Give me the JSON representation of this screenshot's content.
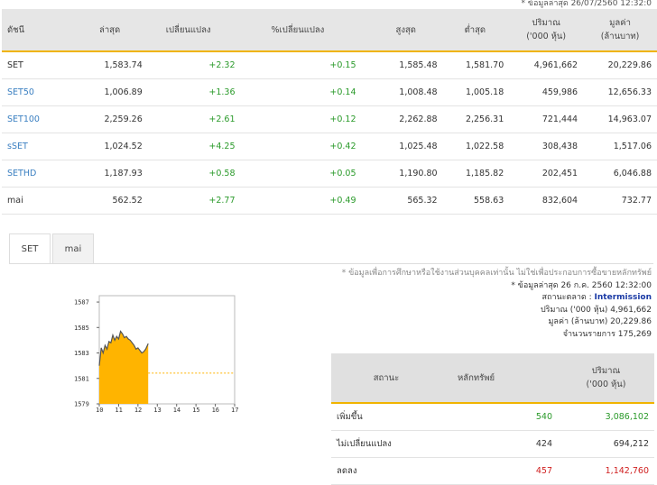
{
  "updated": "* ข้อมูลล่าสุด 26/07/2560 12:32:0",
  "index_table": {
    "headers": [
      {
        "l1": "ดัชนี",
        "l2": ""
      },
      {
        "l1": "ล่าสุด",
        "l2": ""
      },
      {
        "l1": "เปลี่ยนแปลง",
        "l2": ""
      },
      {
        "l1": "%เปลี่ยนแปลง",
        "l2": ""
      },
      {
        "l1": "สูงสุด",
        "l2": ""
      },
      {
        "l1": "ต่ำสุด",
        "l2": ""
      },
      {
        "l1": "ปริมาณ",
        "l2": "('000 หุ้น)"
      },
      {
        "l1": "มูลค่า",
        "l2": "(ล้านบาท)"
      }
    ],
    "rows": [
      {
        "name": "SET",
        "last": "1,583.74",
        "change": "+2.32",
        "pct": "+0.15",
        "high": "1,585.48",
        "low": "1,581.70",
        "volume": "4,961,662",
        "value": "20,229.86"
      },
      {
        "name": "SET50",
        "last": "1,006.89",
        "change": "+1.36",
        "pct": "+0.14",
        "high": "1,008.48",
        "low": "1,005.18",
        "volume": "459,986",
        "value": "12,656.33"
      },
      {
        "name": "SET100",
        "last": "2,259.26",
        "change": "+2.61",
        "pct": "+0.12",
        "high": "2,262.88",
        "low": "2,256.31",
        "volume": "721,444",
        "value": "14,963.07"
      },
      {
        "name": "sSET",
        "last": "1,024.52",
        "change": "+4.25",
        "pct": "+0.42",
        "high": "1,025.48",
        "low": "1,022.58",
        "volume": "308,438",
        "value": "1,517.06"
      },
      {
        "name": "SETHD",
        "last": "1,187.93",
        "change": "+0.58",
        "pct": "+0.05",
        "high": "1,190.80",
        "low": "1,185.82",
        "volume": "202,451",
        "value": "6,046.88"
      },
      {
        "name": "mai",
        "last": "562.52",
        "change": "+2.77",
        "pct": "+0.49",
        "high": "565.32",
        "low": "558.63",
        "volume": "832,604",
        "value": "732.77"
      }
    ]
  },
  "tabs": [
    "SET",
    "mai"
  ],
  "chart_data": {
    "type": "area",
    "title": "",
    "xlabel": "",
    "ylabel": "",
    "x_ticks": [
      "10",
      "11",
      "12",
      "13",
      "14",
      "15",
      "16",
      "17"
    ],
    "y_ticks": [
      "1587",
      "1585",
      "1583",
      "1581",
      "1579"
    ],
    "ylim": [
      1579,
      1587.5
    ],
    "xlim": [
      10,
      17
    ],
    "previous_close": 1581.42,
    "series": [
      {
        "x": [
          10.0,
          10.1,
          10.2,
          10.3,
          10.4,
          10.5,
          10.6,
          10.7,
          10.8,
          10.9,
          11.0,
          11.1,
          11.2,
          11.3,
          11.4,
          11.5,
          11.6,
          11.7,
          11.8,
          11.9,
          12.0,
          12.1,
          12.2,
          12.3,
          12.4,
          12.53
        ],
        "y": [
          1582.0,
          1583.4,
          1583.0,
          1583.6,
          1583.3,
          1583.9,
          1583.8,
          1584.4,
          1584.0,
          1584.3,
          1584.1,
          1584.7,
          1584.5,
          1584.2,
          1584.3,
          1584.1,
          1584.0,
          1583.8,
          1583.6,
          1583.3,
          1583.4,
          1583.2,
          1583.0,
          1583.1,
          1583.3,
          1583.74
        ]
      }
    ],
    "colors": {
      "area": "#ffb400",
      "line": "#555555",
      "ref": "#ffb400"
    }
  },
  "info": {
    "note": "* ข้อมูลเพื่อการศึกษาหรือใช้งานส่วนบุคคลเท่านั้น ไม่ใช่เพื่อประกอบการซื้อขายหลักทรัพย์",
    "updated": "* ข้อมูลล่าสุด 26 ก.ค. 2560 12:32:00",
    "market_status_label": "สถานะตลาด :",
    "market_status": "Intermission",
    "volume": "ปริมาณ ('000 หุ้น) 4,961,662",
    "value": "มูลค่า (ล้านบาท) 20,229.86",
    "deals": "จำนวนรายการ 175,269"
  },
  "summary": {
    "headers": [
      {
        "l1": "สถานะ",
        "l2": ""
      },
      {
        "l1": "หลักทรัพย์",
        "l2": ""
      },
      {
        "l1": "ปริมาณ",
        "l2": "('000 หุ้น)"
      }
    ],
    "rows": [
      {
        "name": "เพิ่มขึ้น",
        "count": "540",
        "volume": "3,086,102",
        "cls": "pos"
      },
      {
        "name": "ไม่เปลี่ยนแปลง",
        "count": "424",
        "volume": "694,212",
        "cls": ""
      },
      {
        "name": "ลดลง",
        "count": "457",
        "volume": "1,142,760",
        "cls": "neg"
      }
    ]
  }
}
